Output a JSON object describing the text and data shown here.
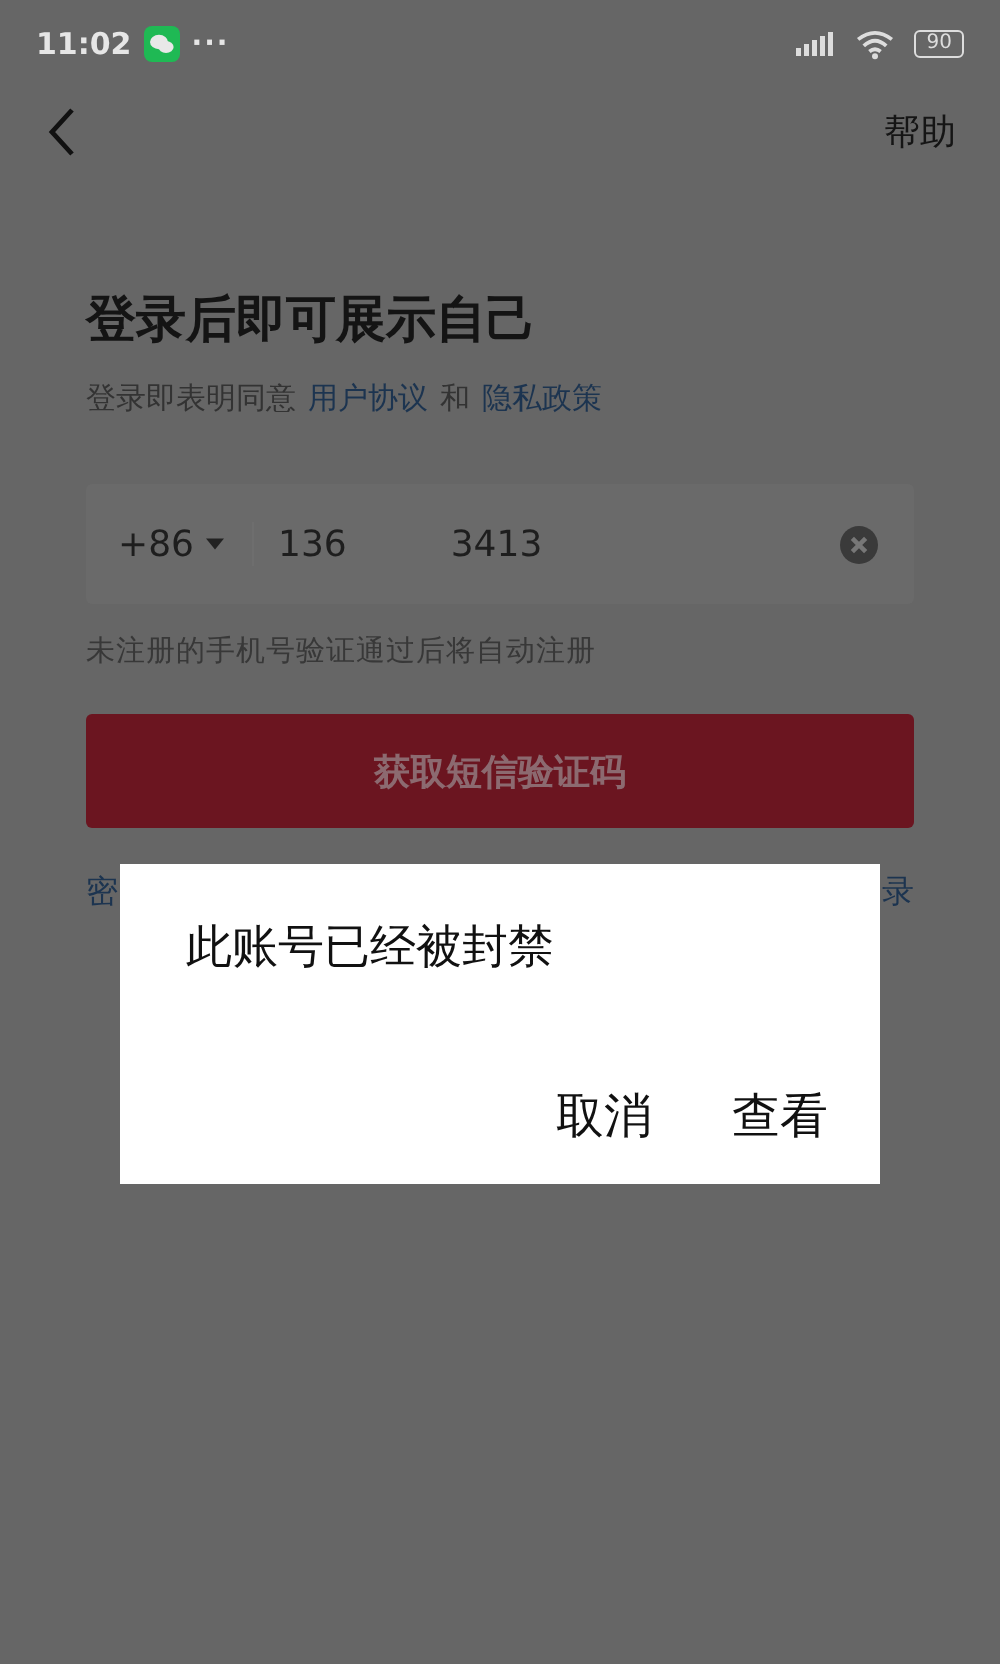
{
  "status_bar": {
    "time": "11:02",
    "more": "···",
    "battery": "90"
  },
  "nav": {
    "help": "帮助"
  },
  "title": "登录后即可展示自己",
  "agreement": {
    "prefix": "登录即表明同意",
    "link_1": "用户协议",
    "joiner": "和",
    "link_2": "隐私政策"
  },
  "phone_field": {
    "country_code": "+86",
    "value_parts": [
      "136",
      "3413"
    ]
  },
  "hint": "未注册的手机号验证通过后将自动注册",
  "sms_button": {
    "label": "获取短信验证码",
    "disabled": true
  },
  "below_links": {
    "left": "密",
    "right": "录"
  },
  "dialog": {
    "message": "此账号已经被封禁",
    "buttons": [
      "取消",
      "查看"
    ]
  }
}
